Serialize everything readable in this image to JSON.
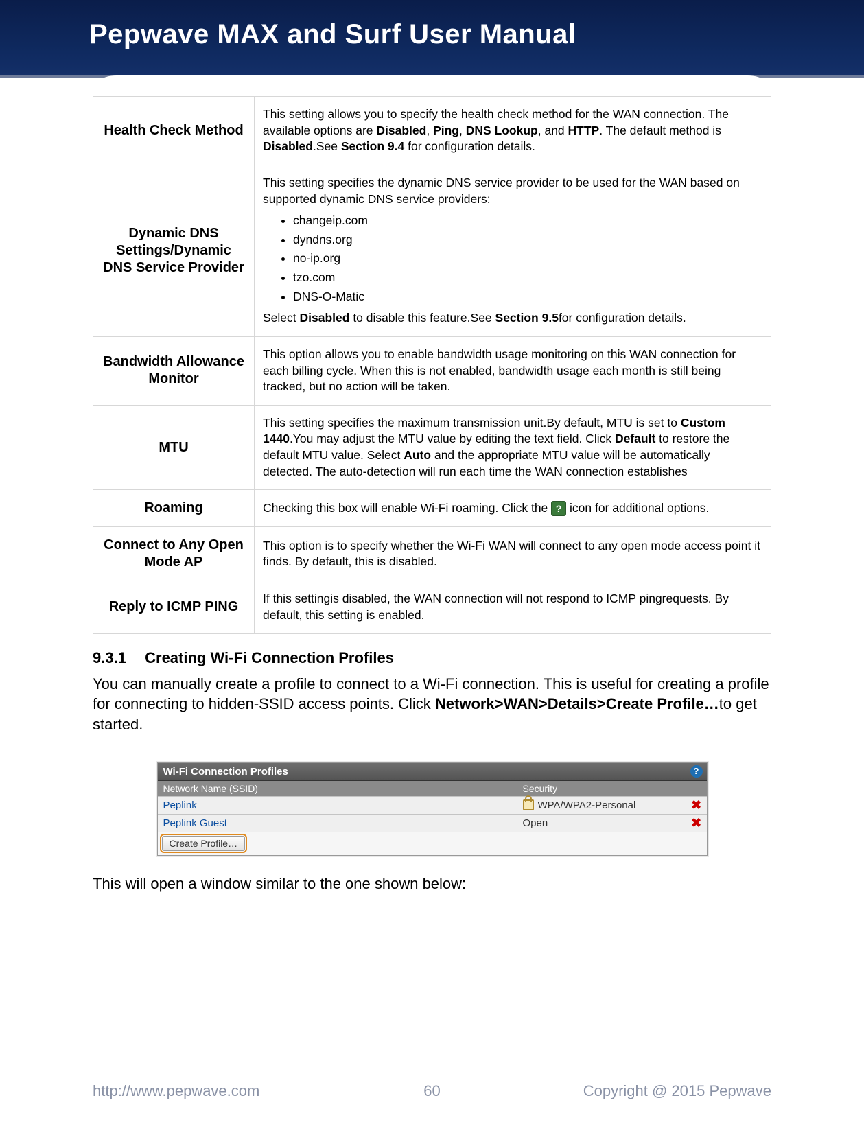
{
  "header": {
    "title": "Pepwave MAX and Surf User Manual"
  },
  "table": {
    "rows": [
      {
        "label": "Health Check Method",
        "desc_html": "This setting allows you to specify the health check method for the WAN connection.  The available options are <b>Disabled</b>, <b>Ping</b>, <b>DNS Lookup</b>, and <b>HTTP</b>. The default method is <b>Disabled</b>.See <b>Section 9.4</b> for configuration details."
      },
      {
        "label": "Dynamic DNS Settings/Dynamic DNS Service Provider",
        "desc_pre": "This setting specifies the dynamic DNS service provider to be used for the WAN based on supported dynamic DNS service providers:",
        "desc_list": [
          "changeip.com",
          "dyndns.org",
          "no-ip.org",
          "tzo.com",
          "DNS-O-Matic"
        ],
        "desc_post_html": "Select <b>Disabled</b> to disable this feature.See <b>Section 9.5</b>for configuration details."
      },
      {
        "label": "Bandwidth Allowance Monitor",
        "desc_html": "This option allows you to enable bandwidth usage monitoring on this WAN connection for each billing cycle. When this is not enabled, bandwidth usage each month is still being tracked, but no action will be taken."
      },
      {
        "label": "MTU",
        "desc_html": "This setting specifies the maximum transmission unit.By default, MTU is set to <b>Custom 1440</b>.You may adjust the MTU value by editing the text field. Click <b>Default</b> to restore the default MTU value. Select <b>Auto</b> and the appropriate MTU value will be automatically detected. The auto-detection will run each time the WAN connection establishes"
      },
      {
        "label": "Roaming",
        "desc_html": "Checking this box will enable Wi-Fi roaming. Click the <span class=\"help-icon\" data-name=\"help-icon\" data-interactable=\"false\">?</span> icon for additional options."
      },
      {
        "label": "Connect to Any Open Mode AP",
        "desc_html": "This option is to specify whether the Wi-Fi WAN will connect to any open mode access point it finds. By default, this is disabled."
      },
      {
        "label": "Reply to ICMP PING",
        "desc_html": "If this settingis disabled, the WAN connection will not respond to ICMP pingrequests. By default, this setting is enabled."
      }
    ]
  },
  "section": {
    "number": "9.3.1",
    "title": "Creating Wi-Fi Connection Profiles",
    "para_html": "You can manually create a profile to connect to a Wi-Fi connection. This is useful for creating a profile for connecting to hidden-SSID access points. Click <b>Network&gt;WAN&gt;Details&gt;Create Profile…</b>to get started.",
    "after_shot": "This will open a window similar to the one shown below:"
  },
  "screenshot": {
    "title": "Wi-Fi Connection Profiles",
    "col1": "Network Name (SSID)",
    "col2": "Security",
    "rows": [
      {
        "ssid": "Peplink",
        "sec": "WPA/WPA2-Personal",
        "lock": true
      },
      {
        "ssid": "Peplink Guest",
        "sec": "Open",
        "lock": false
      }
    ],
    "button": "Create Profile…",
    "delete_glyph": "✖",
    "help_glyph": "?"
  },
  "footer": {
    "url": "http://www.pepwave.com",
    "page": "60",
    "copyright": "Copyright @ 2015 Pepwave"
  }
}
